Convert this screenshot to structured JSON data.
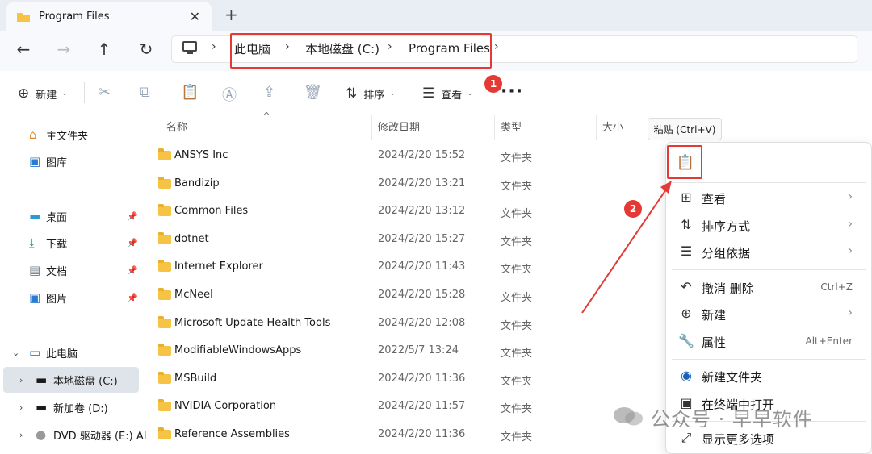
{
  "tab": {
    "title": "Program Files",
    "close": "✕",
    "add": "+"
  },
  "nav": {
    "back": "←",
    "forward": "→",
    "up": "↑",
    "refresh": "↻"
  },
  "breadcrumb": [
    "此电脑",
    "本地磁盘 (C:)",
    "Program Files"
  ],
  "breadcrumb_sep": "›",
  "commands": {
    "new": "新建",
    "sort": "排序",
    "view": "查看",
    "more": "···"
  },
  "badges": {
    "one": "1",
    "two": "2"
  },
  "sidebar": {
    "home": "主文件夹",
    "gallery": "图库",
    "desktop": "桌面",
    "downloads": "下载",
    "documents": "文档",
    "pictures": "图片",
    "this_pc": "此电脑",
    "drive_c": "本地磁盘 (C:)",
    "drive_d": "新加卷 (D:)",
    "drive_e": "DVD 驱动器 (E:) AI"
  },
  "columns": {
    "name": "名称",
    "date": "修改日期",
    "type": "类型",
    "size": "大小"
  },
  "files": [
    {
      "name": "ANSYS Inc",
      "date": "2024/2/20 15:52",
      "type": "文件夹"
    },
    {
      "name": "Bandizip",
      "date": "2024/2/20 13:21",
      "type": "文件夹"
    },
    {
      "name": "Common Files",
      "date": "2024/2/20 13:12",
      "type": "文件夹"
    },
    {
      "name": "dotnet",
      "date": "2024/2/20 15:27",
      "type": "文件夹"
    },
    {
      "name": "Internet Explorer",
      "date": "2024/2/20 11:43",
      "type": "文件夹"
    },
    {
      "name": "McNeel",
      "date": "2024/2/20 15:28",
      "type": "文件夹"
    },
    {
      "name": "Microsoft Update Health Tools",
      "date": "2024/2/20 12:08",
      "type": "文件夹"
    },
    {
      "name": "ModifiableWindowsApps",
      "date": "2022/5/7 13:24",
      "type": "文件夹"
    },
    {
      "name": "MSBuild",
      "date": "2024/2/20 11:36",
      "type": "文件夹"
    },
    {
      "name": "NVIDIA Corporation",
      "date": "2024/2/20 11:57",
      "type": "文件夹"
    },
    {
      "name": "Reference Assemblies",
      "date": "2024/2/20 11:36",
      "type": "文件夹"
    }
  ],
  "tooltip": "粘贴 (Ctrl+V)",
  "context_menu": {
    "view": "查看",
    "sort_by": "排序方式",
    "group_by": "分组依据",
    "undo": "撤消 删除",
    "undo_key": "Ctrl+Z",
    "new": "新建",
    "properties": "属性",
    "properties_key": "Alt+Enter",
    "new_folder": "新建文件夹",
    "open_terminal": "在终端中打开",
    "more_options": "显示更多选项"
  },
  "watermark": "公众号 · 早早软件",
  "colors": {
    "accent": "#e53935",
    "folder": "#f6c344",
    "selected": "#dfe4ea"
  }
}
